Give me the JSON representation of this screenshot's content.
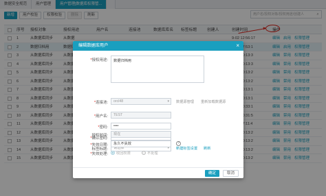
{
  "tabs": [
    "数据安全规范",
    "用户管理",
    "用户管理[数据库权限管...",
    "    "
  ],
  "toolbar": {
    "add": "新增",
    "check": "用户校验",
    "perm_check": "权限校验",
    "delete": "删除",
    "refresh": "刷新"
  },
  "search": {
    "placeholder": "用户名/授权对象/授权用途/创建人"
  },
  "table": {
    "headers": [
      "序号",
      "授权对象",
      "授权用途",
      "用户名",
      "连接池",
      "数据库库名",
      "标签标题",
      "创建人",
      "创建时间",
      "操作"
    ],
    "rows": [
      {
        "no": "1",
        "obj": "从数据库同步",
        "use": "从数据",
        "time": "9-02 12:56:17"
      },
      {
        "no": "2",
        "obj": "数据归档用",
        "use": "数据归",
        "time": "9-02 17:53:1"
      },
      {
        "no": "3",
        "obj": "从数据库同步",
        "use": "从数据",
        "time": "8-16 20:13:3"
      },
      {
        "no": "4",
        "obj": "从数据库同步",
        "use": "从数据",
        "time": "8-16 20:13:3"
      },
      {
        "no": "5",
        "obj": "从数据库同步",
        "use": "从数据",
        "time": "8-16 20:13:2"
      },
      {
        "no": "6",
        "obj": "从数据库同步",
        "use": "从数据",
        "time": "8-16 20:13:2"
      },
      {
        "no": "7",
        "obj": "从数据库同步",
        "use": "从数据",
        "time": "8-16 20:13:1"
      },
      {
        "no": "8",
        "obj": "从数据库同步",
        "use": "从数据",
        "time": "8-16 20:13:1"
      },
      {
        "no": "9",
        "obj": "从数据库同步",
        "use": "从数据",
        "time": "9-02 10:33:1"
      },
      {
        "no": "10",
        "obj": "从数据库同步",
        "use": "从数据",
        "time": "9-02 10:31:5"
      },
      {
        "no": "11",
        "obj": "从数据库同步",
        "use": "从数据",
        "time": "9-01 17:11:4"
      },
      {
        "no": "12",
        "obj": "从数据库同步",
        "use": "从数据",
        "time": "8-16 20:13:2"
      },
      {
        "no": "13",
        "obj": "从数据库同步",
        "use": "从数据",
        "time": "9-02 20:13:2"
      },
      {
        "no": "14",
        "obj": "从数据库同步",
        "use": "从数据",
        "time": "8-16 20:13:2"
      },
      {
        "no": "15",
        "obj": "从数据库同步",
        "use": "从数据",
        "time": "8-16 20:13:2"
      }
    ],
    "ops": [
      "编辑",
      "启用",
      "权限管理"
    ],
    "ops_alt": [
      "编辑",
      "禁用",
      "权限管理"
    ]
  },
  "modal": {
    "title": "编辑数据库用户",
    "close": "×",
    "fields": {
      "purpose_label": "授权用途:",
      "purpose_value": "数据归档用",
      "pool_label": "连接池:",
      "pool_value": "orcl48",
      "pool_manage": "数据源管理",
      "pool_reload": "重新加载数据源",
      "user_label": "用户名:",
      "user_value": "TEST",
      "pwd_label": "密码:",
      "pwd_value": "••••",
      "confirm_label": "确认密码:",
      "confirm_value": "••••",
      "tag_label": "标签标题:",
      "tag_value": "请选择",
      "tag_new": "新建标签设置",
      "tag_refresh": "刷新",
      "auth_time_label": "授权时间:",
      "auth_time_value": "现在",
      "expire_label": "失效日期:",
      "expire_value": "永久不失效",
      "expire_help": "?",
      "handle_label": "失效处理:",
      "handle_opt1": "收回权限",
      "handle_opt2": "不处理"
    },
    "ok": "确定",
    "cancel": "取消"
  },
  "colors": {
    "accent": "#1a9fbf",
    "annotation": "#e0261c"
  }
}
